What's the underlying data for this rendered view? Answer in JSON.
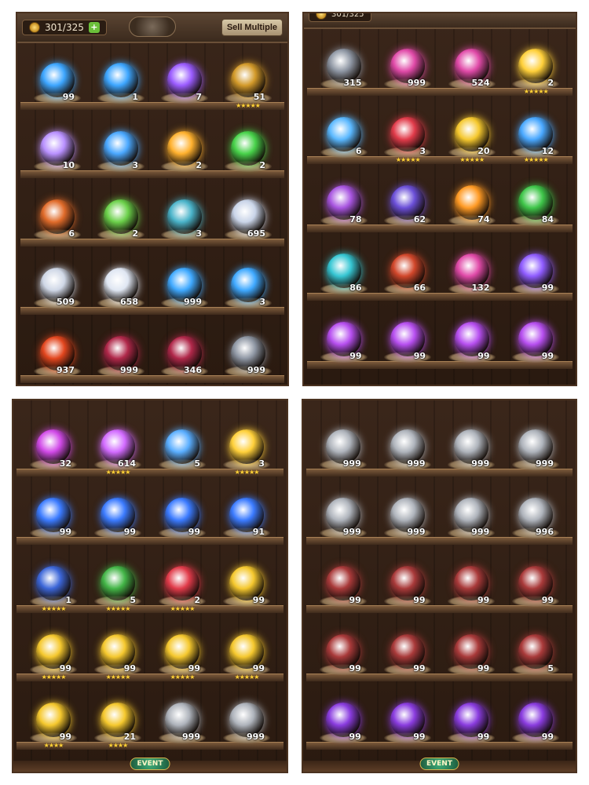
{
  "header": {
    "capacity": "301/325",
    "sell_label": "Sell Multiple"
  },
  "footer": {
    "event_label": "EVENT"
  },
  "panels": [
    {
      "rows": [
        [
          {
            "icon": "crescent-moon-orb-icon",
            "color": "#3da6ff",
            "qty": "99"
          },
          {
            "icon": "crescent-moon-orb-icon",
            "color": "#3da6ff",
            "qty": "1"
          },
          {
            "icon": "violet-star-crystal-icon",
            "color": "#9b5cff",
            "qty": "7"
          },
          {
            "icon": "golden-chest-icon",
            "color": "#d39a2a",
            "qty": "51",
            "stars": "★★★★★"
          }
        ],
        [
          {
            "icon": "feather-staff-icon",
            "color": "#b991ff",
            "qty": "10"
          },
          {
            "icon": "blue-orb-icon",
            "color": "#4aa8ff",
            "qty": "3"
          },
          {
            "icon": "sun-gear-icon",
            "color": "#ffb12e",
            "qty": "2"
          },
          {
            "icon": "green-swirl-gear-icon",
            "color": "#48d24a",
            "qty": "2"
          }
        ],
        [
          {
            "icon": "autumn-leaf-icon",
            "color": "#e06b2a",
            "qty": "6"
          },
          {
            "icon": "green-potion-icon",
            "color": "#6bd04a",
            "qty": "2"
          },
          {
            "icon": "rune-sigil-icon",
            "color": "#4ab3c9",
            "qty": "3"
          },
          {
            "icon": "potion-flask-icon",
            "color": "#c9d4e8",
            "qty": "695"
          }
        ],
        [
          {
            "icon": "scroll-icon",
            "color": "#cfd7e6",
            "qty": "509"
          },
          {
            "icon": "silver-crystal-icon",
            "color": "#dfe6f2",
            "qty": "658"
          },
          {
            "icon": "blue-flame-icon",
            "color": "#3fa9ff",
            "qty": "999"
          },
          {
            "icon": "blue-flame-icon",
            "color": "#3fa9ff",
            "qty": "3"
          }
        ],
        [
          {
            "icon": "lava-rock-icon",
            "color": "#e2461e",
            "qty": "937"
          },
          {
            "icon": "crimson-cloth-icon",
            "color": "#b0284a",
            "qty": "999"
          },
          {
            "icon": "crimson-cloth-icon",
            "color": "#b0284a",
            "qty": "346"
          },
          {
            "icon": "silver-cloth-icon",
            "color": "#8e96a3",
            "qty": "999"
          }
        ]
      ]
    },
    {
      "rows": [
        [
          {
            "icon": "silver-cloth-icon",
            "color": "#8e96a3",
            "qty": "315"
          },
          {
            "icon": "pink-horn-icon",
            "color": "#e04aa8",
            "qty": "999"
          },
          {
            "icon": "pink-horn-icon",
            "color": "#e04aa8",
            "qty": "524"
          },
          {
            "icon": "golden-card-icon",
            "color": "#ffd03a",
            "qty": "2",
            "stars": "★★★★★"
          }
        ],
        [
          {
            "icon": "ur-hero-icon",
            "color": "#5ab8ff",
            "qty": "6"
          },
          {
            "icon": "red-card-icon",
            "color": "#e13b4a",
            "qty": "3",
            "stars": "★★★★★"
          },
          {
            "icon": "gold-elixir-icon",
            "color": "#f5c82e",
            "qty": "20",
            "stars": "★★★★★"
          },
          {
            "icon": "ice-crystal-icon",
            "color": "#49a8ff",
            "qty": "12",
            "stars": "★★★★★"
          }
        ],
        [
          {
            "icon": "purple-dragon-icon",
            "color": "#a855e0",
            "qty": "78"
          },
          {
            "icon": "mystery-shield-icon",
            "color": "#6b4fd8",
            "qty": "62"
          },
          {
            "icon": "orange-shield-icon",
            "color": "#ff9a24",
            "qty": "74"
          },
          {
            "icon": "green-butterfly-shield-icon",
            "color": "#3fc64a",
            "qty": "84"
          }
        ],
        [
          {
            "icon": "cyan-shield-icon",
            "color": "#36c6d3",
            "qty": "86"
          },
          {
            "icon": "skull-shield-icon",
            "color": "#d1472b",
            "qty": "66"
          },
          {
            "icon": "pink-swirl-shield-icon",
            "color": "#e04aa8",
            "qty": "132"
          },
          {
            "icon": "rainbow-orb-icon",
            "color": "#8f5cff",
            "qty": "99"
          }
        ],
        [
          {
            "icon": "rainbow-orb-icon",
            "color": "#b74ff0",
            "qty": "99"
          },
          {
            "icon": "rainbow-orb-icon",
            "color": "#b74ff0",
            "qty": "99"
          },
          {
            "icon": "rainbow-orb-icon",
            "color": "#b74ff0",
            "qty": "99"
          },
          {
            "icon": "rainbow-orb-icon",
            "color": "#b74ff0",
            "qty": "99"
          }
        ]
      ]
    },
    {
      "rows": [
        [
          {
            "icon": "rainbow-orb-icon",
            "color": "#d14ae8",
            "qty": "32"
          },
          {
            "icon": "pink-gold-chest-icon",
            "color": "#d26bff",
            "qty": "614",
            "stars": "★★★★★"
          },
          {
            "icon": "blue-crystal-icon",
            "color": "#5aaeff",
            "qty": "5"
          },
          {
            "icon": "golden-card-icon",
            "color": "#ffd03a",
            "qty": "3",
            "stars": "★★★★★"
          }
        ],
        [
          {
            "icon": "blue-gem-staff-icon",
            "color": "#3b7bff",
            "qty": "99"
          },
          {
            "icon": "blue-gem-staff-icon",
            "color": "#3b7bff",
            "qty": "99"
          },
          {
            "icon": "blue-gem-staff-icon",
            "color": "#3b7bff",
            "qty": "99"
          },
          {
            "icon": "blue-gem-staff-icon",
            "color": "#3b7bff",
            "qty": "91"
          }
        ],
        [
          {
            "icon": "blue-card-icon",
            "color": "#3c66d8",
            "qty": "1",
            "stars": "★★★★★"
          },
          {
            "icon": "green-card-icon",
            "color": "#43b547",
            "qty": "5",
            "stars": "★★★★★"
          },
          {
            "icon": "red-card-icon",
            "color": "#e13b4a",
            "qty": "2",
            "stars": "★★★★★"
          },
          {
            "icon": "gold-elixir-icon",
            "color": "#f5c82e",
            "qty": "99"
          }
        ],
        [
          {
            "icon": "gold-elixir-icon",
            "color": "#f5c82e",
            "qty": "99",
            "stars": "★★★★★"
          },
          {
            "icon": "gold-elixir-icon",
            "color": "#f5c82e",
            "qty": "99",
            "stars": "★★★★★"
          },
          {
            "icon": "gold-elixir-icon",
            "color": "#f5c82e",
            "qty": "99",
            "stars": "★★★★★"
          },
          {
            "icon": "gold-elixir-icon",
            "color": "#f5c82e",
            "qty": "99",
            "stars": "★★★★★"
          }
        ],
        [
          {
            "icon": "gold-elixir-icon",
            "color": "#f5c82e",
            "qty": "99",
            "stars": "★★★★"
          },
          {
            "icon": "gold-elixir-icon",
            "color": "#f5c82e",
            "qty": "21",
            "stars": "★★★★"
          },
          {
            "icon": "silver-anvil-icon",
            "color": "#aeb3bb",
            "qty": "999"
          },
          {
            "icon": "silver-anvil-icon",
            "color": "#aeb3bb",
            "qty": "999"
          }
        ]
      ]
    },
    {
      "rows": [
        [
          {
            "icon": "silver-anvil-icon",
            "color": "#aeb3bb",
            "qty": "999"
          },
          {
            "icon": "silver-anvil-icon",
            "color": "#aeb3bb",
            "qty": "999"
          },
          {
            "icon": "silver-anvil-icon",
            "color": "#aeb3bb",
            "qty": "999"
          },
          {
            "icon": "silver-anvil-icon",
            "color": "#aeb3bb",
            "qty": "999"
          }
        ],
        [
          {
            "icon": "silver-anvil-icon",
            "color": "#aeb3bb",
            "qty": "999"
          },
          {
            "icon": "silver-anvil-icon",
            "color": "#aeb3bb",
            "qty": "999"
          },
          {
            "icon": "silver-anvil-icon",
            "color": "#aeb3bb",
            "qty": "999"
          },
          {
            "icon": "silver-anvil-icon",
            "color": "#aeb3bb",
            "qty": "996"
          }
        ],
        [
          {
            "icon": "red-hammer-icon",
            "color": "#a93a3a",
            "qty": "99"
          },
          {
            "icon": "red-hammer-icon",
            "color": "#a93a3a",
            "qty": "99"
          },
          {
            "icon": "red-hammer-icon",
            "color": "#a93a3a",
            "qty": "99"
          },
          {
            "icon": "red-hammer-icon",
            "color": "#a93a3a",
            "qty": "99"
          }
        ],
        [
          {
            "icon": "red-hammer-icon",
            "color": "#a93a3a",
            "qty": "99"
          },
          {
            "icon": "red-hammer-icon",
            "color": "#a93a3a",
            "qty": "99"
          },
          {
            "icon": "red-hammer-icon",
            "color": "#a93a3a",
            "qty": "99"
          },
          {
            "icon": "red-hammer-icon",
            "color": "#a93a3a",
            "qty": "5"
          }
        ],
        [
          {
            "icon": "purple-gem-icon",
            "color": "#8a3cdf",
            "qty": "99"
          },
          {
            "icon": "purple-gem-icon",
            "color": "#8a3cdf",
            "qty": "99"
          },
          {
            "icon": "purple-gem-icon",
            "color": "#8a3cdf",
            "qty": "99"
          },
          {
            "icon": "purple-gem-icon",
            "color": "#8a3cdf",
            "qty": "99"
          }
        ]
      ]
    }
  ]
}
